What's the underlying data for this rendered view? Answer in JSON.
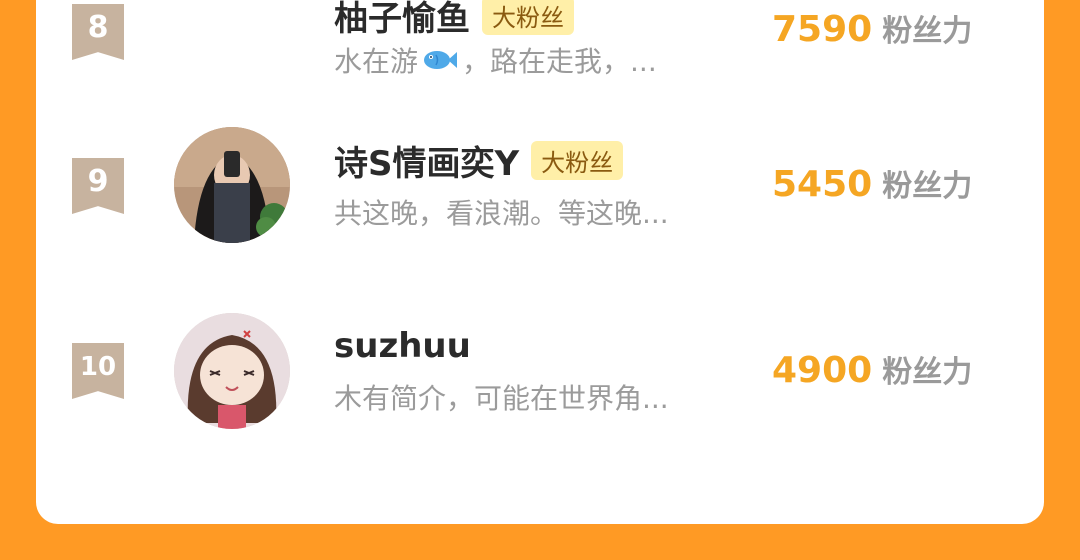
{
  "fans_list": {
    "rows": [
      {
        "rank": "8",
        "name": "柚子愉鱼",
        "badge": "大粉丝",
        "bio_before_icon": "水在游",
        "bio_icon": "fish-icon",
        "bio_after_icon": "，路在走我，...",
        "score": "7590",
        "unit": "粉丝力"
      },
      {
        "rank": "9",
        "name": "诗S情画奕Y",
        "badge": "大粉丝",
        "bio": "共这晚，看浪潮。等这晚...",
        "score": "5450",
        "unit": "粉丝力"
      },
      {
        "rank": "10",
        "name": "suzhuu",
        "bio": "木有简介，可能在世界角...",
        "score": "4900",
        "unit": "粉丝力"
      }
    ]
  },
  "colors": {
    "background": "#FF9A24",
    "score": "#F5A623",
    "rank_badge": "#C7B39F",
    "fan_badge_bg": "#FFEFA8"
  }
}
